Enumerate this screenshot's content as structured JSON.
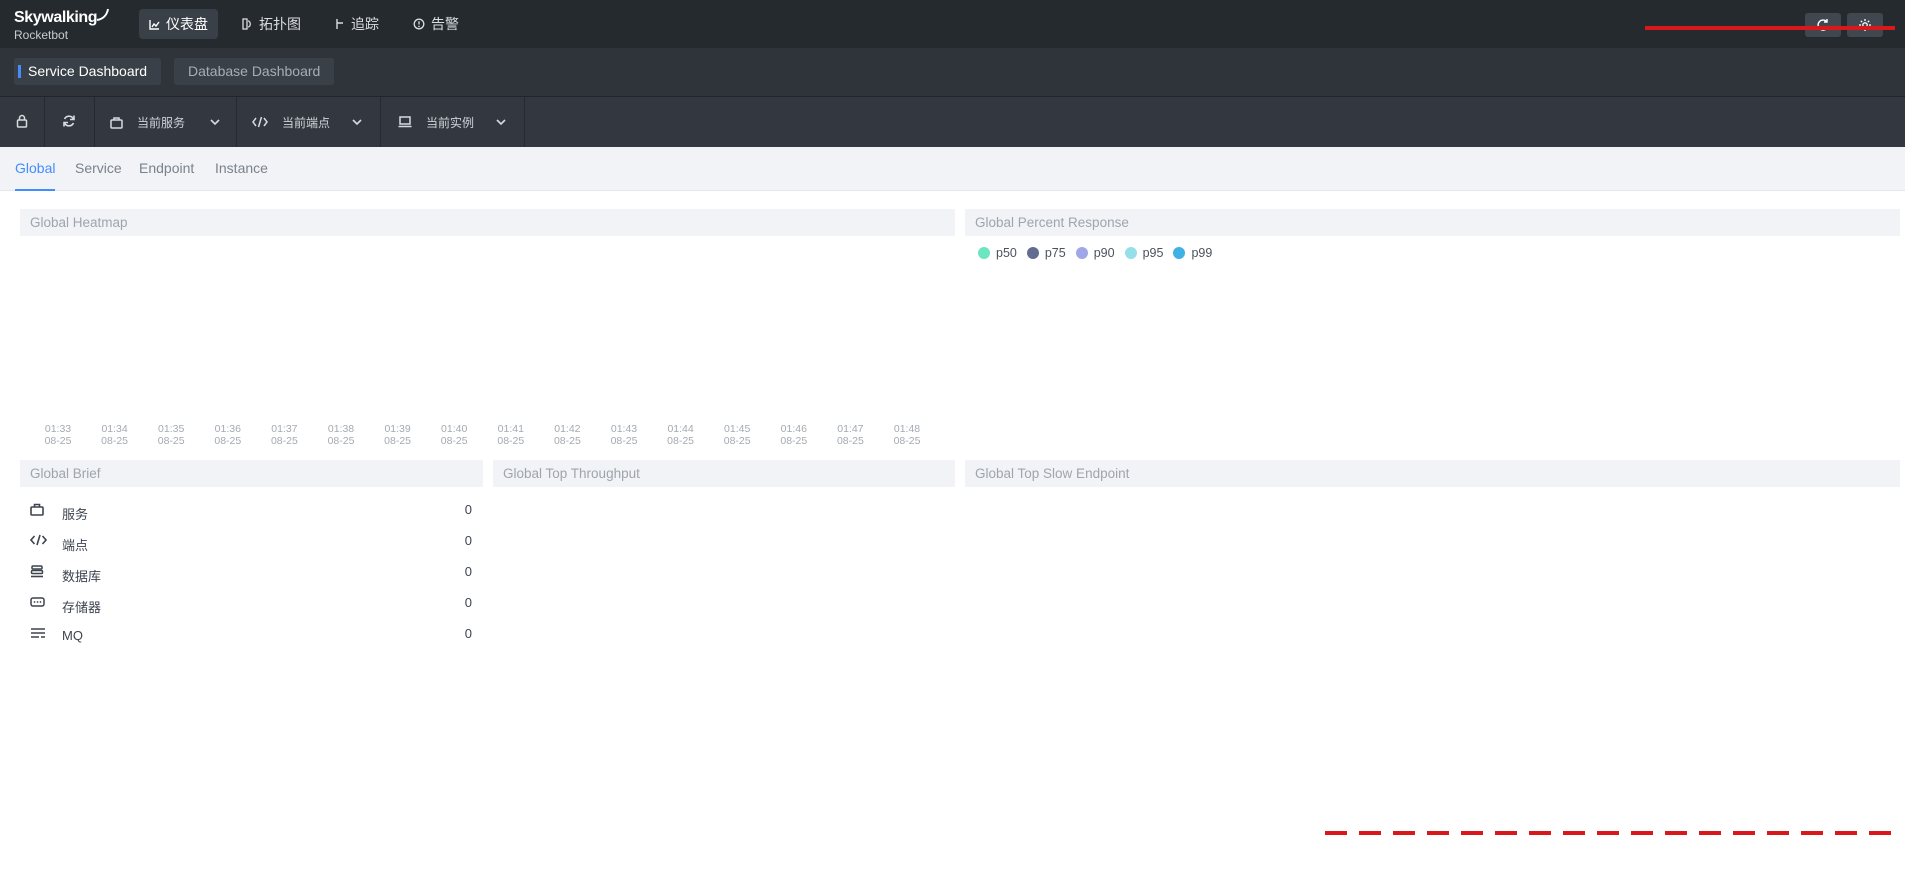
{
  "app": {
    "logo_main": "Skywalking",
    "logo_sub": "Rocketbot"
  },
  "nav": [
    {
      "label": "仪表盘",
      "icon": "chart-icon",
      "active": true
    },
    {
      "label": "拓扑图",
      "icon": "topology-icon",
      "active": false
    },
    {
      "label": "追踪",
      "icon": "trace-icon",
      "active": false
    },
    {
      "label": "告警",
      "icon": "alarm-icon",
      "active": false
    }
  ],
  "dashboards": [
    {
      "label": "Service Dashboard",
      "active": true
    },
    {
      "label": "Database Dashboard",
      "active": false
    }
  ],
  "toolbar": {
    "service_label": "当前服务",
    "endpoint_label": "当前端点",
    "instance_label": "当前实例"
  },
  "tabs": [
    "Global",
    "Service",
    "Endpoint",
    "Instance"
  ],
  "panels": {
    "heatmap_title": "Global Heatmap",
    "percent_title": "Global Percent Response",
    "brief_title": "Global Brief",
    "throughput_title": "Global Top Throughput",
    "slow_title": "Global Top Slow Endpoint"
  },
  "heatmap_times": [
    {
      "time": "01:33",
      "date": "08-25"
    },
    {
      "time": "01:34",
      "date": "08-25"
    },
    {
      "time": "01:35",
      "date": "08-25"
    },
    {
      "time": "01:36",
      "date": "08-25"
    },
    {
      "time": "01:37",
      "date": "08-25"
    },
    {
      "time": "01:38",
      "date": "08-25"
    },
    {
      "time": "01:39",
      "date": "08-25"
    },
    {
      "time": "01:40",
      "date": "08-25"
    },
    {
      "time": "01:41",
      "date": "08-25"
    },
    {
      "time": "01:42",
      "date": "08-25"
    },
    {
      "time": "01:43",
      "date": "08-25"
    },
    {
      "time": "01:44",
      "date": "08-25"
    },
    {
      "time": "01:45",
      "date": "08-25"
    },
    {
      "time": "01:46",
      "date": "08-25"
    },
    {
      "time": "01:47",
      "date": "08-25"
    },
    {
      "time": "01:48",
      "date": "08-25"
    }
  ],
  "percent_legend": [
    {
      "name": "p50",
      "color": "#6be6c1"
    },
    {
      "name": "p75",
      "color": "#626c91"
    },
    {
      "name": "p90",
      "color": "#a0a7e6"
    },
    {
      "name": "p95",
      "color": "#96dee8"
    },
    {
      "name": "p99",
      "color": "#3fb1e3"
    }
  ],
  "brief": [
    {
      "label": "服务",
      "value": "0",
      "icon": "service-icon"
    },
    {
      "label": "端点",
      "value": "0",
      "icon": "endpoint-icon"
    },
    {
      "label": "数据库",
      "value": "0",
      "icon": "database-icon"
    },
    {
      "label": "存储器",
      "value": "0",
      "icon": "cache-icon"
    },
    {
      "label": "MQ",
      "value": "0",
      "icon": "mq-icon"
    }
  ],
  "colors": {
    "accent": "#448dfe",
    "topbar": "#252a2f",
    "toolbar": "#333840"
  }
}
